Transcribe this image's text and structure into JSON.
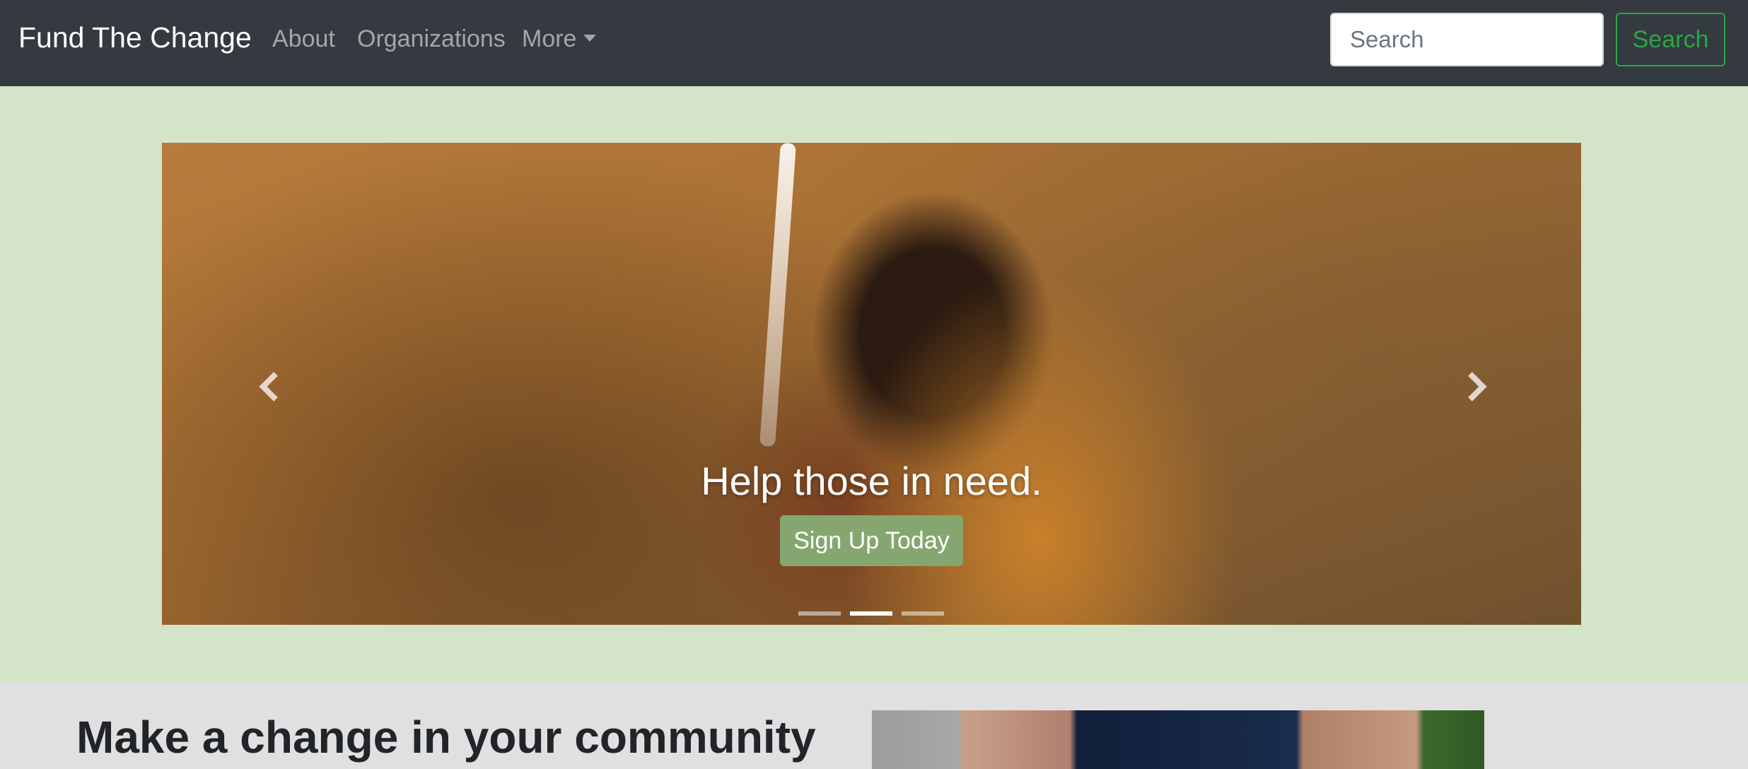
{
  "navbar": {
    "brand": "Fund The Change",
    "links": [
      "About",
      "Organizations"
    ],
    "more_label": "More",
    "search_placeholder": "Search",
    "search_button_label": "Search",
    "background": "#343a40",
    "accent": "#28a745"
  },
  "hero": {
    "background": "#d4e4c8",
    "caption": "Help those in need.",
    "cta_label": "Sign Up Today",
    "cta_color": "#86a670",
    "indicators": [
      "slide-1",
      "slide-2",
      "slide-3"
    ],
    "active_indicator": 2,
    "prev_icon": "chevron-left-icon",
    "next_icon": "chevron-right-icon"
  },
  "section": {
    "heading": "Make a change in your community"
  }
}
